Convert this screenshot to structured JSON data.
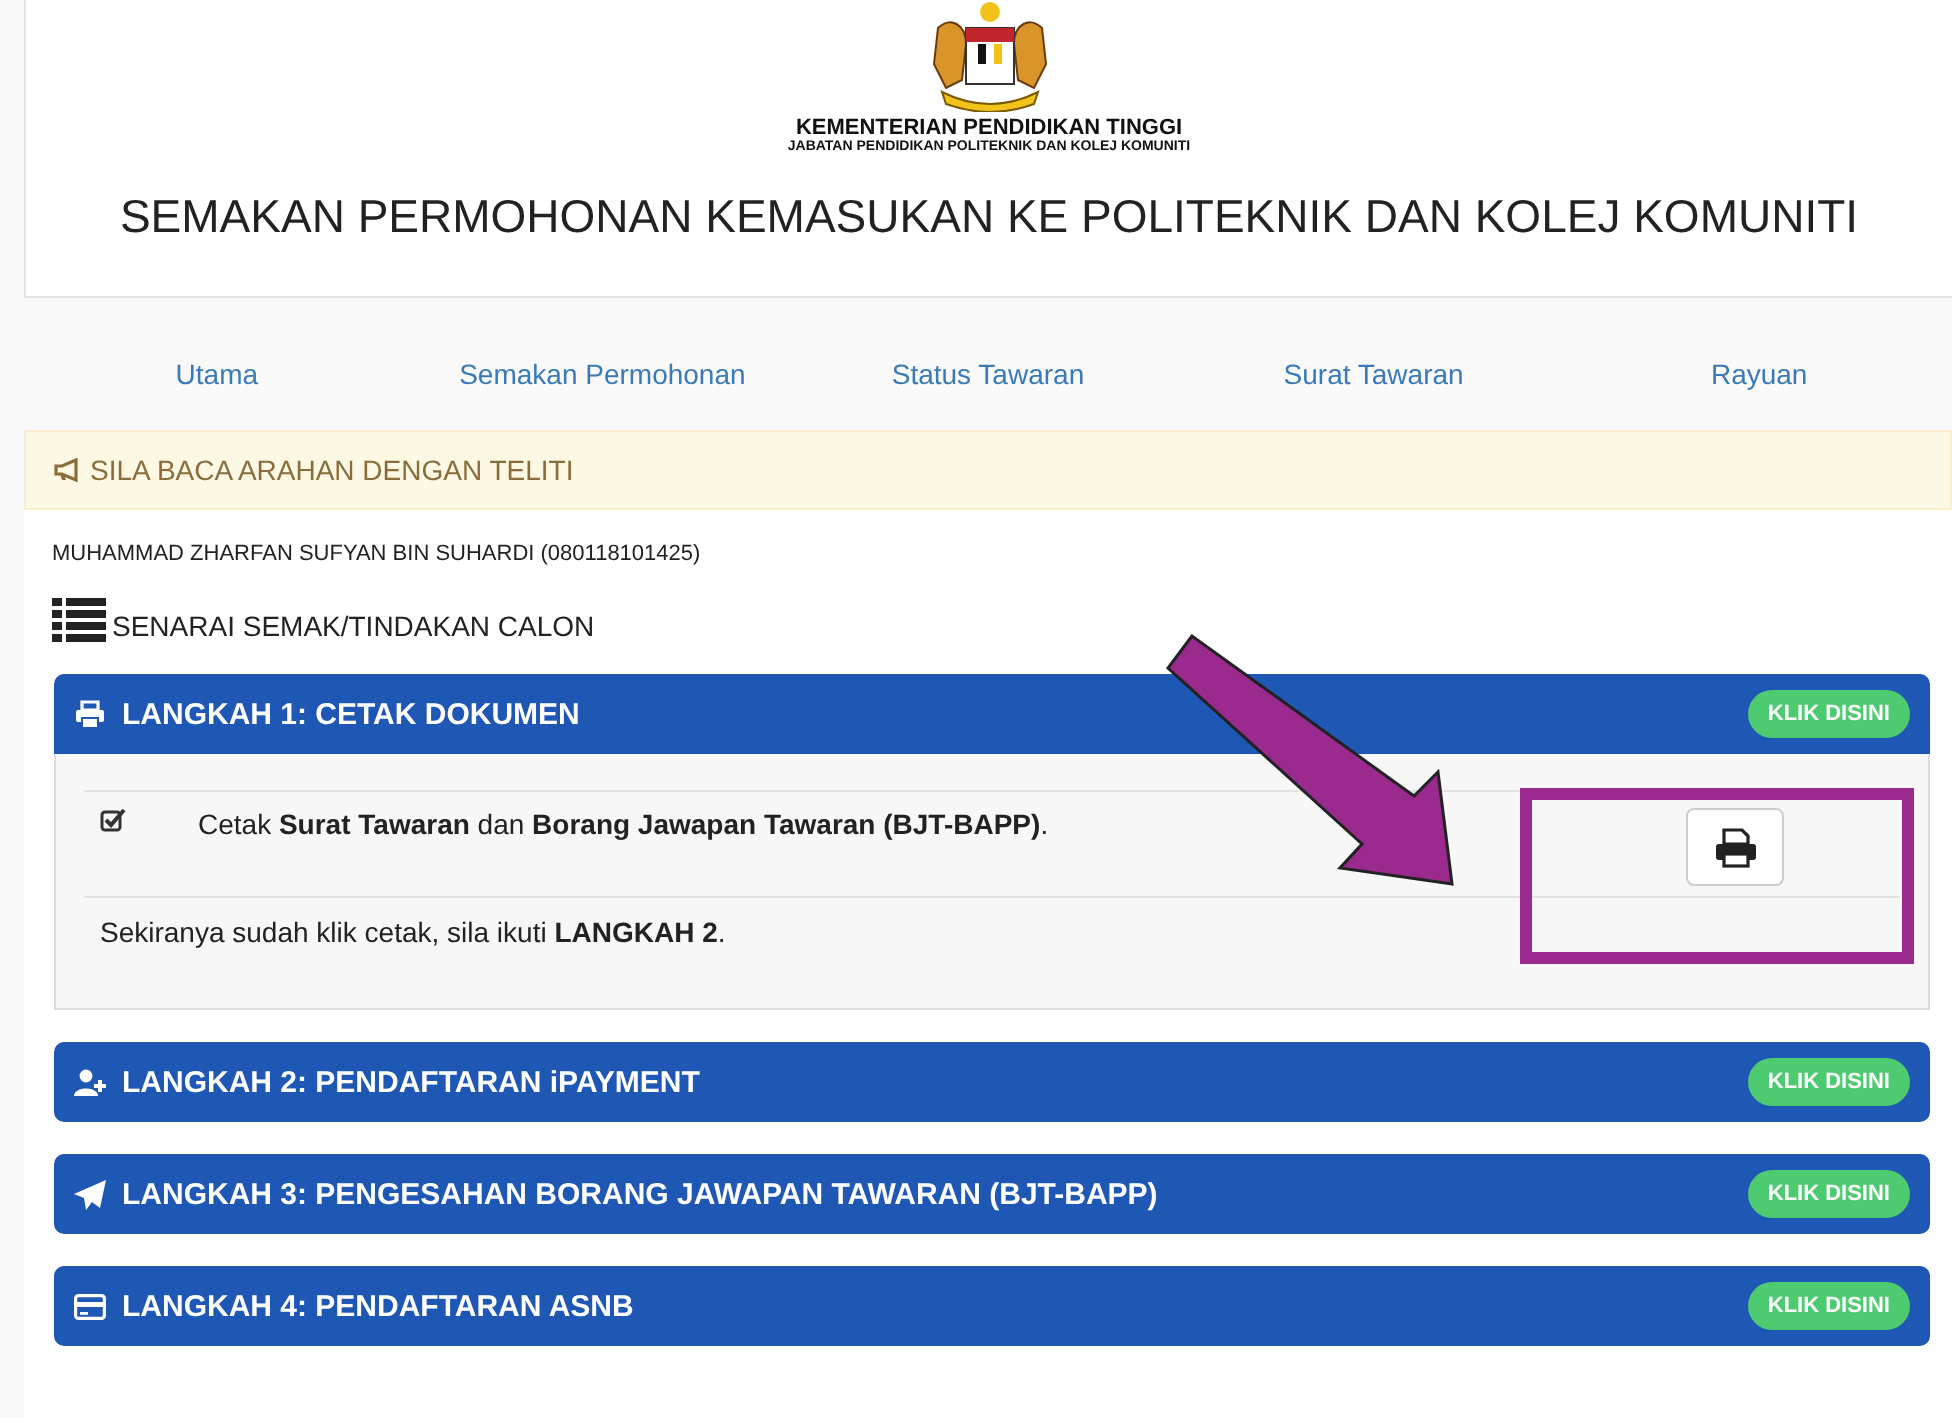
{
  "header": {
    "ministry": "KEMENTERIAN PENDIDIKAN TINGGI",
    "department": "JABATAN PENDIDIKAN POLITEKNIK DAN KOLEJ KOMUNITI",
    "title": "SEMAKAN PERMOHONAN KEMASUKAN KE POLITEKNIK DAN KOLEJ KOMUNITI"
  },
  "nav": [
    {
      "label": "Utama"
    },
    {
      "label": "Semakan Permohonan"
    },
    {
      "label": "Status Tawaran"
    },
    {
      "label": "Surat Tawaran"
    },
    {
      "label": "Rayuan"
    }
  ],
  "notice": "SILA BACA ARAHAN DENGAN TELITI",
  "candidate": "MUHAMMAD ZHARFAN SUFYAN BIN SUHARDI (080118101425)",
  "checklist_title": "SENARAI SEMAK/TINDAKAN CALON",
  "steps": [
    {
      "title": "LANGKAH 1: CETAK DOKUMEN",
      "button": "KLIK DISINI",
      "expanded": true,
      "tasks": [
        {
          "text": "Cetak **Surat Tawaran** dan **Borang Jawapan Tawaran (BJT-BAPP)**.",
          "checked": true
        }
      ],
      "note": "Sekiranya sudah klik cetak, sila ikuti **LANGKAH 2**."
    },
    {
      "title": "LANGKAH 2: PENDAFTARAN iPAYMENT",
      "button": "KLIK DISINI",
      "expanded": false
    },
    {
      "title": "LANGKAH 3: PENGESAHAN BORANG JAWAPAN TAWARAN (BJT-BAPP)",
      "button": "KLIK DISINI",
      "expanded": false
    },
    {
      "title": "LANGKAH 4: PENDAFTARAN ASNB",
      "button": "KLIK DISINI",
      "expanded": false
    }
  ]
}
